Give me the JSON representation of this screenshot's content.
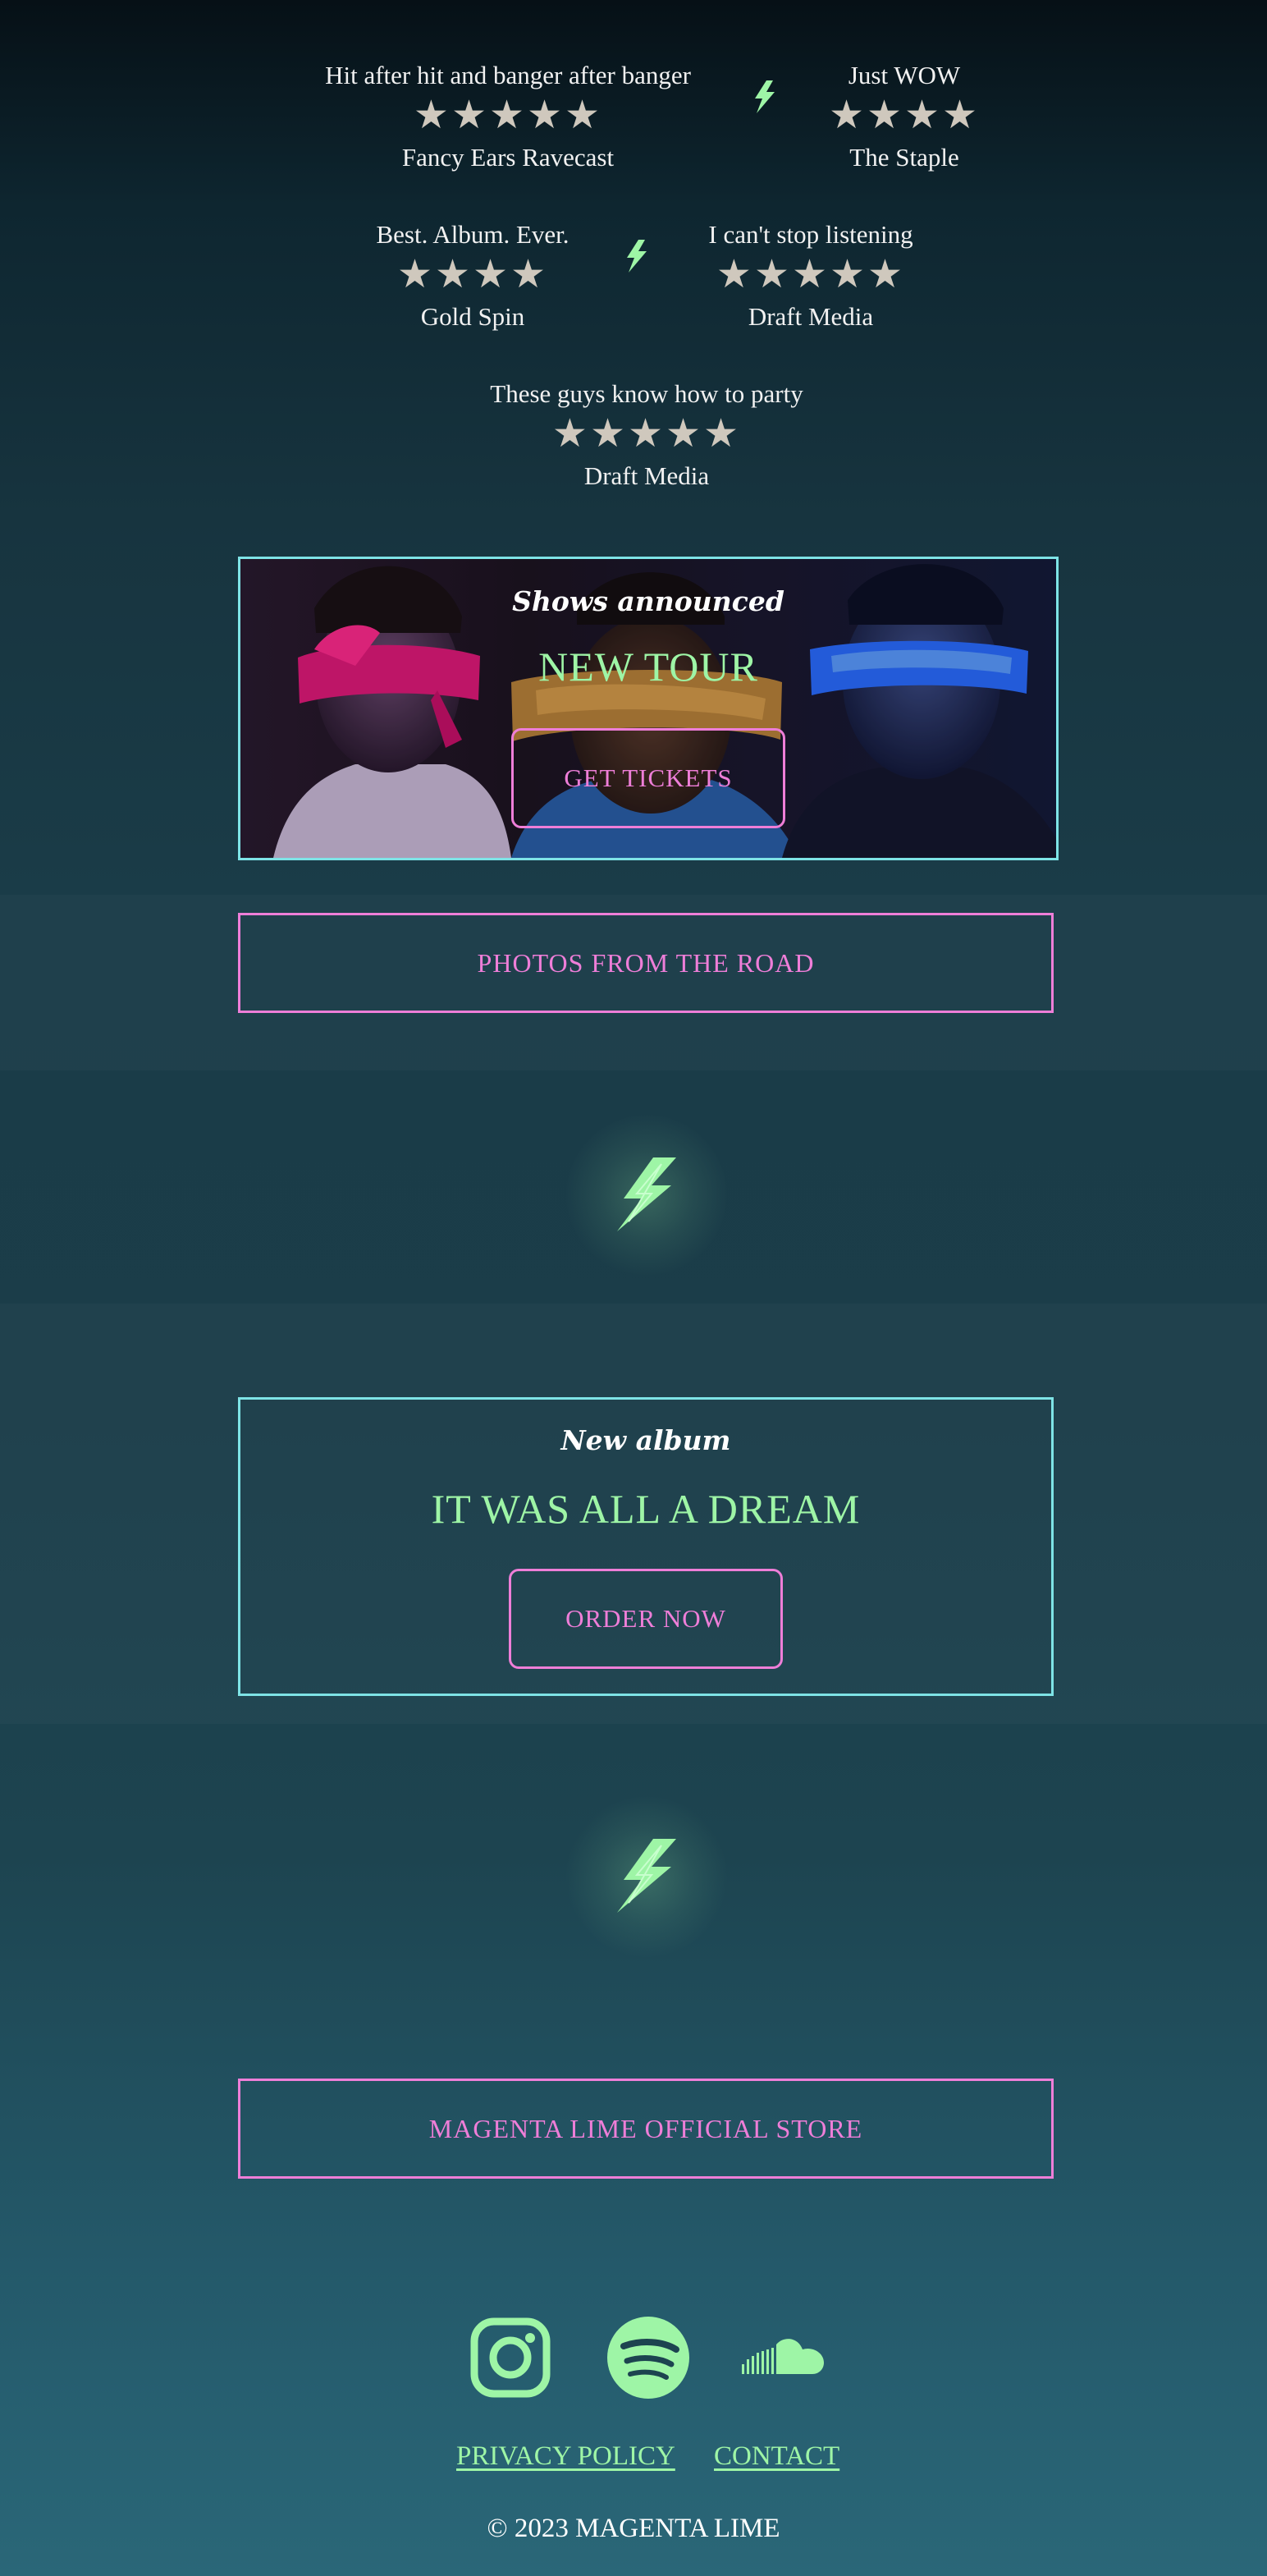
{
  "reviews": [
    {
      "quote": "Hit after hit and banger after banger",
      "stars": "★★★★★",
      "rating": 5,
      "source": "Fancy Ears Ravecast"
    },
    {
      "quote": "Just WOW",
      "stars": "★★★★",
      "rating": 4,
      "source": "The Staple"
    },
    {
      "quote": "Best. Album. Ever.",
      "stars": "★★★★",
      "rating": 4,
      "source": "Gold Spin"
    },
    {
      "quote": "I can't stop listening",
      "stars": "★★★★★",
      "rating": 5,
      "source": "Draft Media"
    },
    {
      "quote": "These guys know how to party",
      "stars": "★★★★★",
      "rating": 5,
      "source": "Draft Media"
    }
  ],
  "tour": {
    "eyebrow": "Shows announced",
    "title": "NEW TOUR",
    "button": "GET TICKETS"
  },
  "photos_button": "PHOTOS FROM THE ROAD",
  "album": {
    "eyebrow": "New album",
    "title": "IT WAS ALL A DREAM",
    "button": "ORDER NOW"
  },
  "store_button": "MAGENTA LIME OFFICIAL STORE",
  "socials": [
    {
      "icon": "instagram-icon"
    },
    {
      "icon": "spotify-icon"
    },
    {
      "icon": "soundcloud-icon"
    }
  ],
  "footer": {
    "privacy": "PRIVACY POLICY",
    "contact": "CONTACT",
    "copyright": "© 2023 MAGENTA LIME"
  },
  "colors": {
    "lime": "#9ef5a6",
    "magenta": "#ee7ed8",
    "cyan": "#7ee3e6",
    "star": "#cfc8bd"
  }
}
